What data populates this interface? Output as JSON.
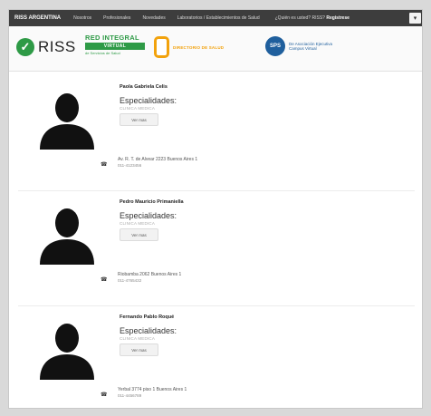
{
  "navbar": {
    "brand": "RISS ARGENTINA",
    "links": [
      "Nosotros",
      "Profesionales",
      "Novedades",
      "Laboratorios / Establecimientos de Salud"
    ],
    "login_prefix": "¿Quién es usted? RISS?",
    "login_action": "Registrese"
  },
  "logos": {
    "riss": "RISS",
    "red_integral_line1": "RED INTEGRAL",
    "red_integral_line2": "VIRTUAL",
    "red_integral_line3": "de Servicios de Salud",
    "directorio": "DIRECTORIO DE SALUD",
    "campus_badge": "SPS",
    "campus_text": "De Asociación Ejecutiva Campus Virtual"
  },
  "doctors": [
    {
      "name": "Paola Gabriela Celis",
      "especialidades_label": "Especialidades:",
      "especialidad": "CLINICA MEDICA",
      "ver_mas": "Ver mas",
      "address": "Av. R. T. de Alvear 2223 Buenos Aires 1",
      "phone": "011-4123456"
    },
    {
      "name": "Pedro Mauricio Primaniella",
      "especialidades_label": "Especialidades:",
      "especialidad": "CLINICA MEDICA",
      "ver_mas": "Ver mas",
      "address": "Riobamba 2062 Buenos Aires 1",
      "phone": "011-4765432"
    },
    {
      "name": "Fernando Pablo Roqué",
      "especialidades_label": "Especialidades:",
      "especialidad": "CLINICA MEDICA",
      "ver_mas": "Ver mas",
      "address": "Yerbal 3774 piso 1 Buenos Aires 1",
      "phone": "011-4456789"
    }
  ],
  "colors": {
    "navbar_bg": "#3d3d3d",
    "riss_green": "#2e9a46",
    "directorio_orange": "#f2a20c",
    "campus_blue": "#1f5f9d"
  }
}
